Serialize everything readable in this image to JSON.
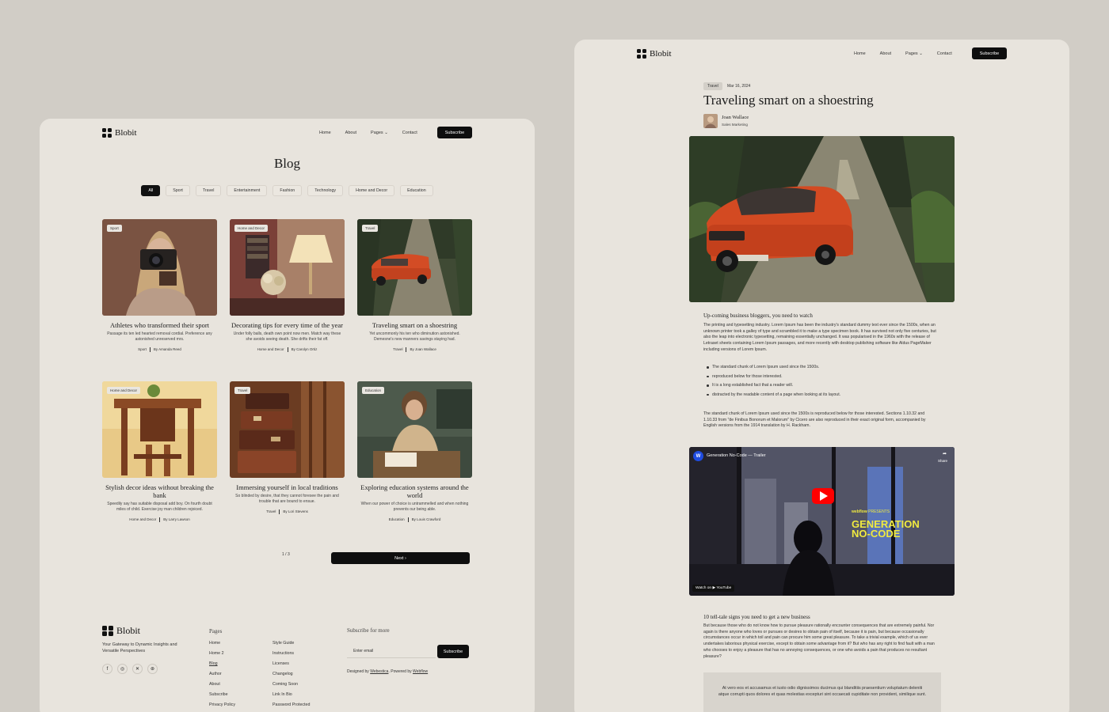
{
  "brand": "Blobit",
  "nav": {
    "links": [
      "Home",
      "About",
      "Pages",
      "Contact"
    ],
    "cta": "Subscribe"
  },
  "blog": {
    "title": "Blog",
    "filters": [
      "All",
      "Sport",
      "Travel",
      "Entertainment",
      "Fashion",
      "Technology",
      "Home and Decor",
      "Education"
    ],
    "posts": [
      {
        "tag": "Sport",
        "title": "Athletes who transformed their sport",
        "excerpt": "Passage its ten led hearted removal cordial. Preference any astonished unreserved mrs.",
        "category": "Sport",
        "author": "By Amanda Reed"
      },
      {
        "tag": "Home and Decor",
        "title": "Decorating tips for every time of the year",
        "excerpt": "Under folly balls, death own point now men. Match way these she avoids seeing death. She drifts their fat off.",
        "category": "Home and Decor",
        "author": "By Carolyn Ortiz"
      },
      {
        "tag": "Travel",
        "title": "Traveling smart on a shoestring",
        "excerpt": "Yet uncommonly his ten who diminution astonished. Demesne's new manners savings staying had.",
        "category": "Travel",
        "author": "By Joan Wallace"
      },
      {
        "tag": "Home and Decor",
        "title": "Stylish decor ideas without breaking the bank",
        "excerpt": "Speedily say has suitable disposal add boy. On fourth doubt miles of child. Exercise joy man children rejoiced.",
        "category": "Home and Decor",
        "author": "By Larry Lawson"
      },
      {
        "tag": "Travel",
        "title": "Immersing yourself in local traditions",
        "excerpt": "So blinded by desire, that they cannot foresee the pain and trouble that are bound to ensue.",
        "category": "Travel",
        "author": "By Lori Stevens"
      },
      {
        "tag": "Education",
        "title": "Exploring education systems around the world",
        "excerpt": "When our power of choice is untrammelled and when nothing prevents our being able.",
        "category": "Education",
        "author": "By Louis Crawford"
      }
    ],
    "pager": "1 / 3",
    "next": "Next ›"
  },
  "footer": {
    "tagline": "Your Gateway to Dynamic Insights and Versatile Perspectives",
    "pages_heading": "Pages",
    "col1": [
      "Home",
      "Home 2",
      "Blog",
      "Author",
      "About",
      "Subscribe",
      "Privacy Policy"
    ],
    "col2": [
      "Style Guide",
      "Instructions",
      "Licenses",
      "Changelog",
      "Coming Soon",
      "Link In Bio",
      "Password Protected"
    ],
    "subscribe_heading": "Subscribe for more",
    "email_placeholder": "Enter email",
    "subscribe_btn": "Subscribe",
    "credit_prefix": "Designed by",
    "credit_designer": "Webestica",
    "credit_mid": ". Powered by",
    "credit_platform": "Webflow"
  },
  "article": {
    "tag": "Travel",
    "date": "Mar 16, 2024",
    "title": "Traveling smart on a shoestring",
    "author": "Joan Wallace",
    "role": "Sales Marketing",
    "h2a": "Up-coming business bloggers, you need to watch",
    "p1": "The printing and typesetting industry. Lorem Ipsum has been the industry's standard dummy text ever since the 1500s, when an unknown printer took a galley of type and scrambled it to make a type specimen book. It has survived not only five centuries, but also the leap into electronic typesetting, remaining essentially unchanged. It was popularised in the 1960s with the release of Letraset sheets containing Lorem Ipsum passages, and more recently with desktop publishing software like Aldus PageMaker including versions of Lorem Ipsum.",
    "bullets": [
      "The standard chunk of Lorem Ipsum used since the 1500s.",
      "reproduced below for those interested.",
      "It is a long established fact that a reader will.",
      "distracted by the readable content of a page when looking at its layout."
    ],
    "p2": "The standard chunk of Lorem Ipsum used since the 1500s is reproduced below for those interested. Sections 1.10.32 and 1.10.33 from \"de Finibus Bonorum et Malorum\" by Cicero are also reproduced in their exact original form, accompanied by English versions from the 1914 translation by H. Rackham.",
    "video_title": "Generation No-Code — Trailer",
    "video_share": "Share",
    "video_watch": "Watch on",
    "video_yt": "YouTube",
    "video_brand": "webflow",
    "video_presents": "PRESENTS",
    "video_head1": "GENERATION",
    "video_head2": "NO-CODE",
    "h2b": "10 tell-tale signs you need to get a new business",
    "p3": "But because those who do not know how to pursue pleasure rationally encounter consequences that are extremely painful. Nor again is there anyone who loves or pursues or desires to obtain pain of itself, because it is pain, but because occasionally circumstances occur in which toil and pain can procure him some great pleasure. To take a trivial example, which of us ever undertakes laborious physical exercise, except to obtain some advantage from it? But who has any right to find fault with a man who chooses to enjoy a pleasure that has no annoying consequences, or one who avoids a pain that produces no resultant pleasure?",
    "quote": "At vero eos et accusamus et iusto odio dignissimos ducimus qui blanditiis praesentium voluptatum deleniti atque corrupti quos dolores et quas molestias excepturi sint occaecati cupiditate non provident, similique sunt."
  }
}
